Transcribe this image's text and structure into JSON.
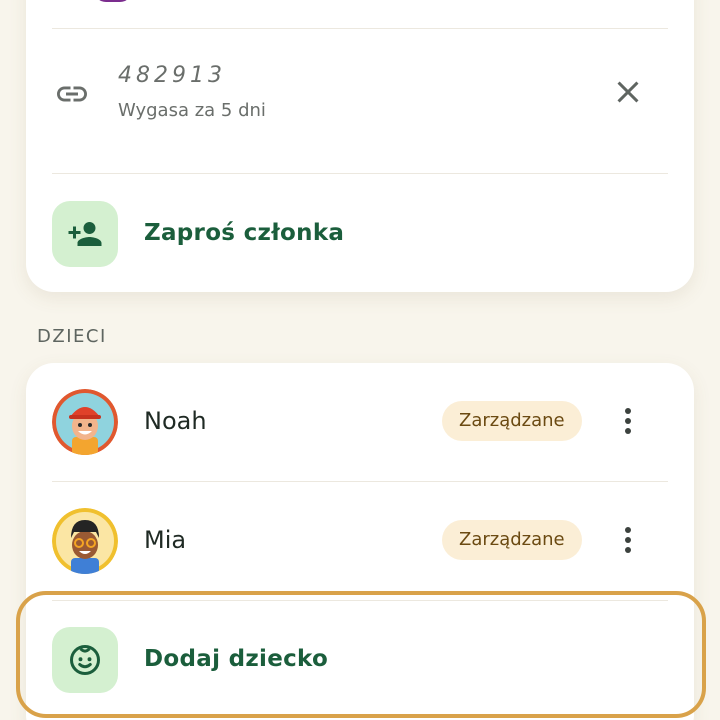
{
  "invite": {
    "code": "482913",
    "expires": "Wygasa za 5 dni",
    "link_icon": "link-icon",
    "close_icon": "close-icon"
  },
  "invite_member": {
    "label": "Zaproś członka",
    "icon": "person-add-icon"
  },
  "children_section": {
    "title": "DZIECI",
    "children": [
      {
        "name": "Noah",
        "badge": "Zarządzane",
        "avatar_icon": "kid-avatar-red-cap"
      },
      {
        "name": "Mia",
        "badge": "Zarządzane",
        "avatar_icon": "kid-avatar-glasses"
      }
    ],
    "more_icon": "more-vertical-icon"
  },
  "add_child": {
    "label": "Dodaj dziecko",
    "icon": "child-face-icon"
  },
  "colors": {
    "background": "#f8f5ec",
    "accent_green": "#1b5e3c",
    "icon_tile": "#d4f0d0",
    "badge_bg": "#fbeed6",
    "highlight": "#d9a24a"
  }
}
